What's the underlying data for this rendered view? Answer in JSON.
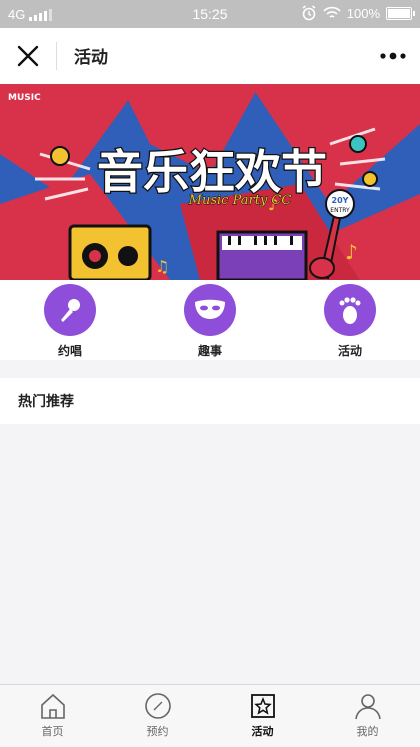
{
  "status_bar": {
    "network": "4G",
    "time": "15:25",
    "battery": "100%"
  },
  "nav": {
    "title": "活动"
  },
  "banner": {
    "title": "音乐狂欢节",
    "subtitle": "Music Party CC",
    "badge_line1": "20Y",
    "badge_line2": "ENTRY",
    "corner_text": "MUSIC"
  },
  "categories": [
    {
      "label": "约唱",
      "icon": "microphone-icon"
    },
    {
      "label": "趣事",
      "icon": "mask-icon"
    },
    {
      "label": "活动",
      "icon": "footprint-icon"
    }
  ],
  "hot_section": {
    "title": "热门推荐"
  },
  "tabbar": {
    "items": [
      {
        "label": "首页",
        "icon": "home-icon",
        "active": false
      },
      {
        "label": "预约",
        "icon": "compass-icon",
        "active": false
      },
      {
        "label": "活动",
        "icon": "star-icon",
        "active": true
      },
      {
        "label": "我的",
        "icon": "user-icon",
        "active": false
      }
    ]
  },
  "colors": {
    "accent": "#8e4ed9",
    "banner_red": "#d8324a",
    "banner_blue": "#2f5fb8"
  }
}
